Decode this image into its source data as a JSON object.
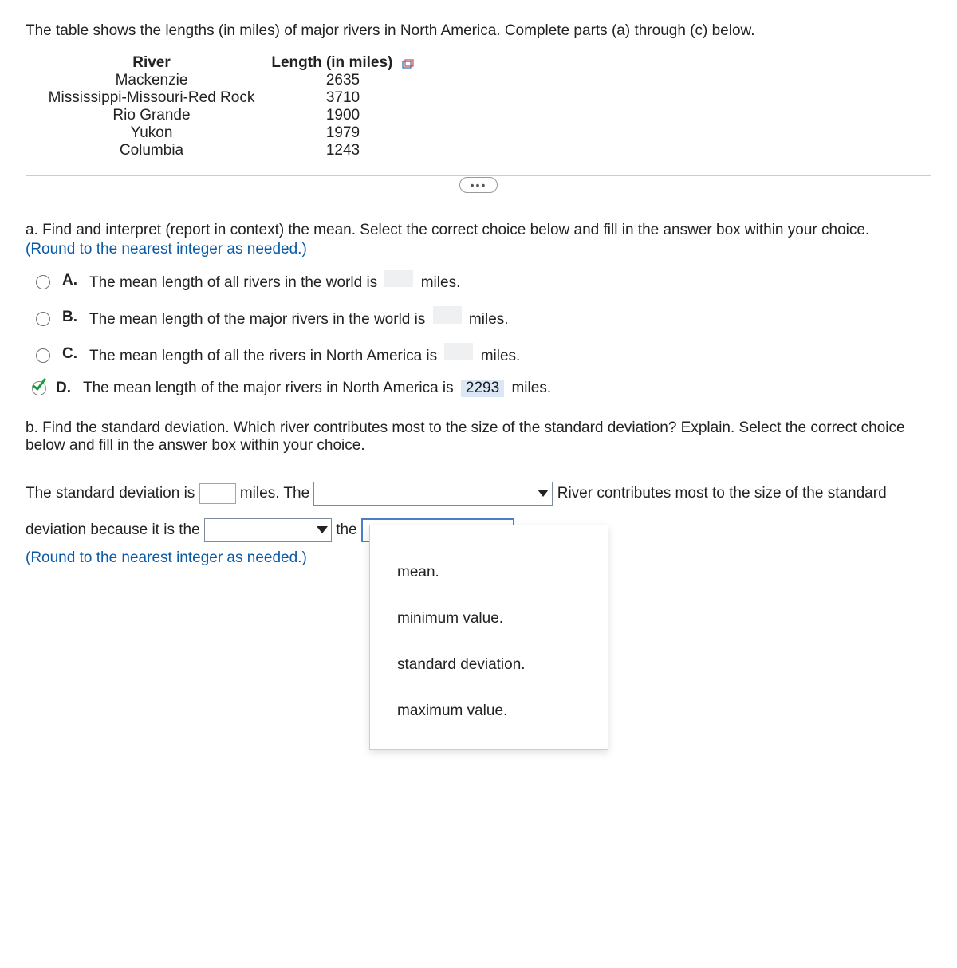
{
  "intro": "The table shows the lengths (in miles) of major rivers in North America. Complete parts (a) through (c) below.",
  "table": {
    "headers": {
      "river": "River",
      "length": "Length (in miles)"
    },
    "rows": [
      {
        "river": "Mackenzie",
        "length": "2635"
      },
      {
        "river": "Mississippi-Missouri-Red Rock",
        "length": "3710"
      },
      {
        "river": "Rio Grande",
        "length": "1900"
      },
      {
        "river": "Yukon",
        "length": "1979"
      },
      {
        "river": "Columbia",
        "length": "1243"
      }
    ]
  },
  "more_label": "…",
  "part_a": {
    "prompt": "a. Find and interpret (report in context) the mean. Select the correct choice below and fill in the answer box within your choice.",
    "hint": "(Round to the nearest integer as needed.)",
    "choices": {
      "A": {
        "letter": "A.",
        "pre": "The mean length of all rivers in the world is",
        "post": "miles."
      },
      "B": {
        "letter": "B.",
        "pre": "The mean length of the major rivers in the world is",
        "post": "miles."
      },
      "C": {
        "letter": "C.",
        "pre": "The mean length of all the rivers in North America is",
        "post": "miles."
      },
      "D": {
        "letter": "D.",
        "pre": "The mean length of the major rivers in North America is",
        "value": "2293",
        "post": "miles."
      }
    }
  },
  "part_b": {
    "prompt": "b. Find the standard deviation. Which river contributes most to the size of the standard deviation? Explain. Select the correct choice below and fill in the answer box within your choice.",
    "sentence": {
      "seg1": "The standard deviation is",
      "seg2": "miles. The",
      "seg3": "River contributes most to the size of the standard",
      "seg4": "deviation because it is the",
      "seg5": "the",
      "hint": "(Round to the nearest integer as needed.)"
    },
    "dropdown_options": [
      "mean.",
      "minimum value.",
      "standard deviation.",
      "maximum value."
    ]
  }
}
